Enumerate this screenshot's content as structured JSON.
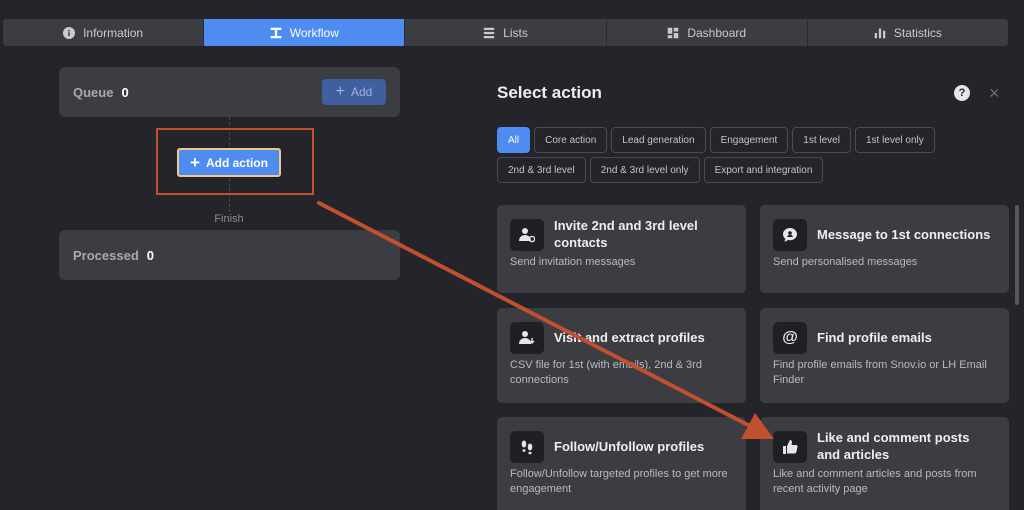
{
  "tabs": [
    {
      "label": "Information",
      "icon": "info-icon",
      "active": false
    },
    {
      "label": "Workflow",
      "icon": "workflow-icon",
      "active": true
    },
    {
      "label": "Lists",
      "icon": "list-icon",
      "active": false
    },
    {
      "label": "Dashboard",
      "icon": "dashboard-icon",
      "active": false
    },
    {
      "label": "Statistics",
      "icon": "chart-icon",
      "active": false
    }
  ],
  "queue": {
    "label": "Queue",
    "count": "0",
    "add_label": "Add"
  },
  "add_action": {
    "label": "Add action"
  },
  "finish_label": "Finish",
  "processed": {
    "label": "Processed",
    "count": "0"
  },
  "panel": {
    "title": "Select action",
    "help": "?",
    "close": "×"
  },
  "filters": [
    {
      "label": "All",
      "active": true
    },
    {
      "label": "Core action",
      "active": false
    },
    {
      "label": "Lead generation",
      "active": false
    },
    {
      "label": "Engagement",
      "active": false
    },
    {
      "label": "1st level",
      "active": false
    },
    {
      "label": "1st level only",
      "active": false
    },
    {
      "label": "2nd & 3rd level",
      "active": false
    },
    {
      "label": "2nd & 3rd level only",
      "active": false
    },
    {
      "label": "Export and integration",
      "active": false
    }
  ],
  "actions": [
    {
      "title": "Invite 2nd and 3rd level contacts",
      "desc": "Send invitation messages",
      "icon": "invite-user-icon"
    },
    {
      "title": "Message to 1st connections",
      "desc": "Send personalised messages",
      "icon": "message-icon"
    },
    {
      "title": "Visit and extract profiles",
      "desc": "CSV file for 1st (with emails), 2nd & 3rd connections",
      "icon": "extract-profile-icon"
    },
    {
      "title": "Find profile emails",
      "desc": "Find profile emails from Snov.io or LH Email Finder",
      "icon": "at-sign-icon"
    },
    {
      "title": "Follow/Unfollow profiles",
      "desc": "Follow/Unfollow targeted profiles to get more engagement",
      "icon": "footprints-icon"
    },
    {
      "title": "Like and comment posts and articles",
      "desc": "Like and comment articles and posts from recent activity page",
      "icon": "thumbs-up-icon"
    }
  ],
  "colors": {
    "accent": "#4e8cf2",
    "annotation": "#c0502e",
    "background": "#24252a",
    "card": "#3c3d43"
  }
}
